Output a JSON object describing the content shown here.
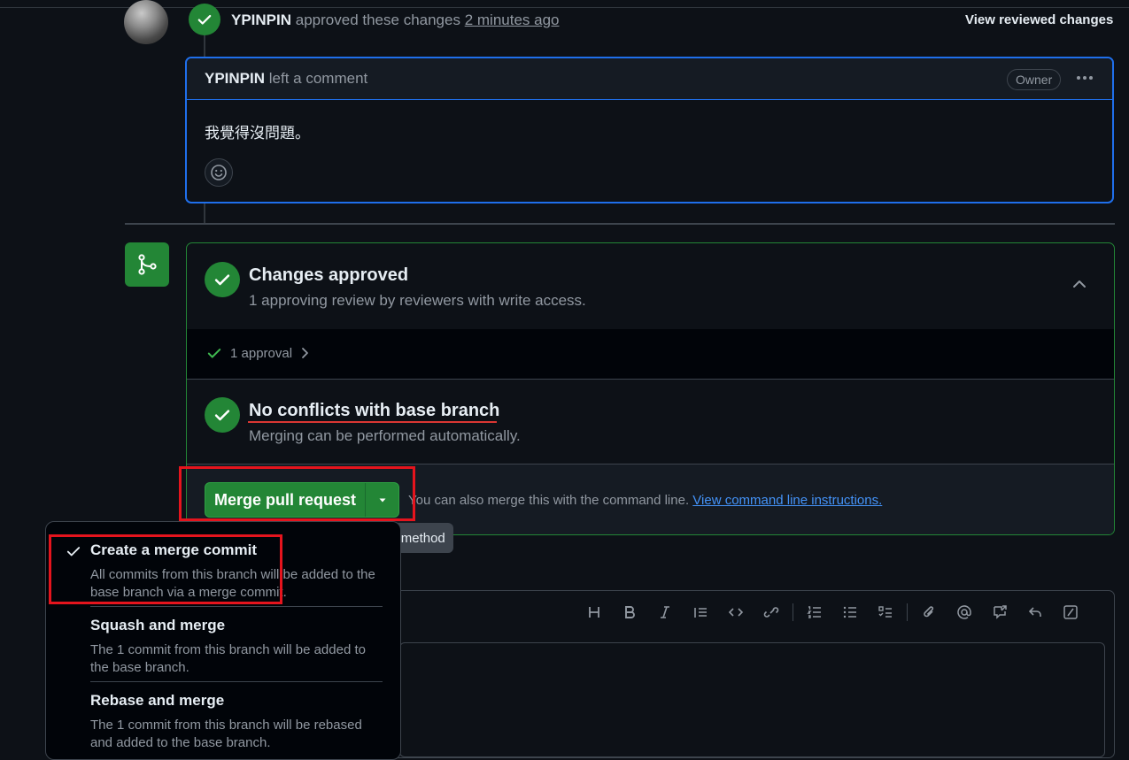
{
  "review": {
    "user": "YPINPIN",
    "action": "approved these changes",
    "time": "2 minutes ago",
    "view_reviewed": "View reviewed changes"
  },
  "comment": {
    "user": "YPINPIN",
    "action": "left a comment",
    "owner_badge": "Owner",
    "body": "我覺得沒問題。"
  },
  "merge": {
    "approved_title": "Changes approved",
    "approved_sub": "1 approving review by reviewers with write access.",
    "approvals_label": "1 approval",
    "conflicts_title": "No conflicts with base branch",
    "conflicts_sub": "Merging can be performed automatically.",
    "merge_button": "Merge pull request",
    "cmd_text": "You can also merge this with the command line.",
    "cmd_link": "View command line instructions.",
    "tooltip": "Select merge method"
  },
  "merge_methods": [
    {
      "title": "Create a merge commit",
      "desc": "All commits from this branch will be added to the base branch via a merge commit.",
      "selected": true
    },
    {
      "title": "Squash and merge",
      "desc": "The 1 commit from this branch will be added to the base branch.",
      "selected": false
    },
    {
      "title": "Rebase and merge",
      "desc": "The 1 commit from this branch will be rebased and added to the base branch.",
      "selected": false
    }
  ],
  "icons": [
    "check-icon",
    "kebab-icon",
    "smiley-icon",
    "git-merge-icon",
    "chevron-up-icon",
    "chevron-right-icon",
    "triangle-down-icon",
    "heading-icon",
    "bold-icon",
    "italic-icon",
    "quote-icon",
    "code-icon",
    "link-icon",
    "ordered-list-icon",
    "unordered-list-icon",
    "tasklist-icon",
    "paperclip-icon",
    "mention-icon",
    "cross-reference-icon",
    "reply-icon",
    "slash-icon"
  ],
  "colors": {
    "accent_green": "#238636",
    "link_blue": "#4493f8",
    "focus_blue": "#1f6feb",
    "annotation_red": "#e5141d"
  }
}
